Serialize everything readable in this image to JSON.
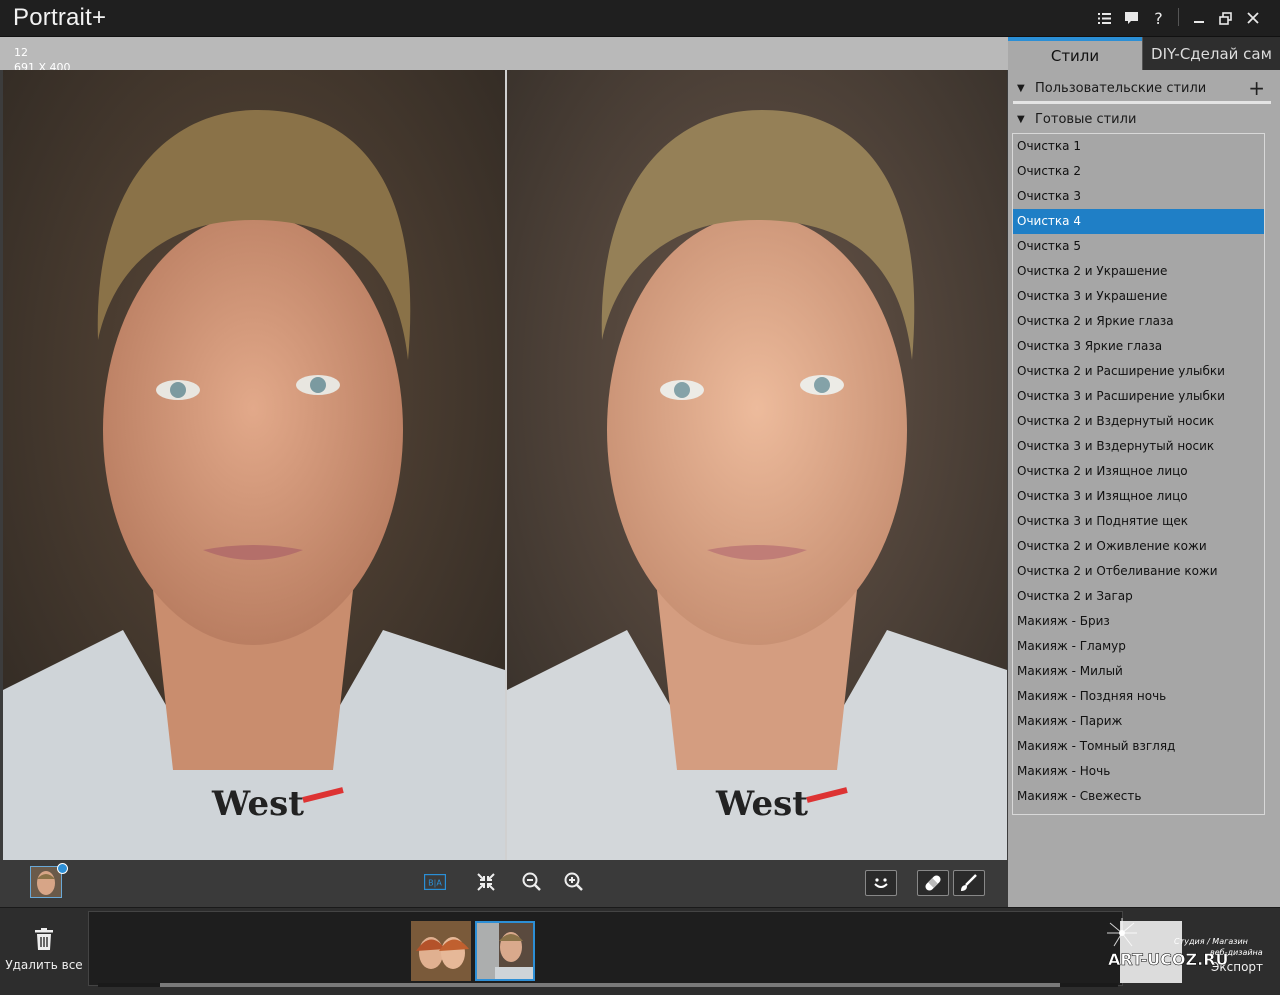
{
  "app": {
    "title": "Portrait+"
  },
  "titlebar": {
    "icons": [
      "list-icon",
      "feedback-icon",
      "help-icon",
      "minimize-icon",
      "restore-icon",
      "close-icon"
    ],
    "help": "?"
  },
  "canvas": {
    "index": "12",
    "dimensions": "691 X 400"
  },
  "panel": {
    "tabs": [
      {
        "label": "Стили",
        "active": true
      },
      {
        "label": "DIY-Сделай сам",
        "active": false
      }
    ],
    "custom_styles": {
      "label": "Пользовательские стили",
      "add": "+"
    },
    "ready_styles": {
      "label": "Готовые стили"
    },
    "styles": [
      "Очистка 1",
      "Очистка 2",
      "Очистка 3",
      "Очистка 4",
      "Очистка 5",
      "Очистка 2 и Украшение",
      "Очистка 3 и Украшение",
      "Очистка 2 и Яркие глаза",
      "Очистка 3 Яркие глаза",
      "Очистка 2 и Расширение улыбки",
      "Очистка 3 и Расширение улыбки",
      "Очистка 2 и Вздернутый носик",
      "Очистка 3 и Вздернутый носик",
      "Очистка 2 и Изящное лицо",
      "Очистка 3 и Изящное лицо",
      "Очистка 3 и Поднятие щек",
      "Очистка 2 и Оживление кожи",
      "Очистка 2 и Отбеливание кожи",
      "Очистка 2 и Загар",
      "Макияж - Бриз",
      "Макияж - Гламур",
      "Макияж - Милый",
      "Макияж - Поздняя ночь",
      "Макияж - Париж",
      "Макияж - Томный взгляд",
      "Макияж - Ночь",
      "Макияж - Свежесть"
    ],
    "selected_index": 3
  },
  "toolbar": {
    "ba": "B|A"
  },
  "bottom": {
    "delete_label": "Удалить все",
    "export_label": "Экспорт"
  },
  "watermark": {
    "site": "ART-UCOZ.RU",
    "tagline1": "Студия / Магазин",
    "tagline2": "веб-дизайна"
  },
  "colors": {
    "accent": "#1f7fc6",
    "panel": "#a9a9a9",
    "titlebar": "#1f1f1f"
  }
}
